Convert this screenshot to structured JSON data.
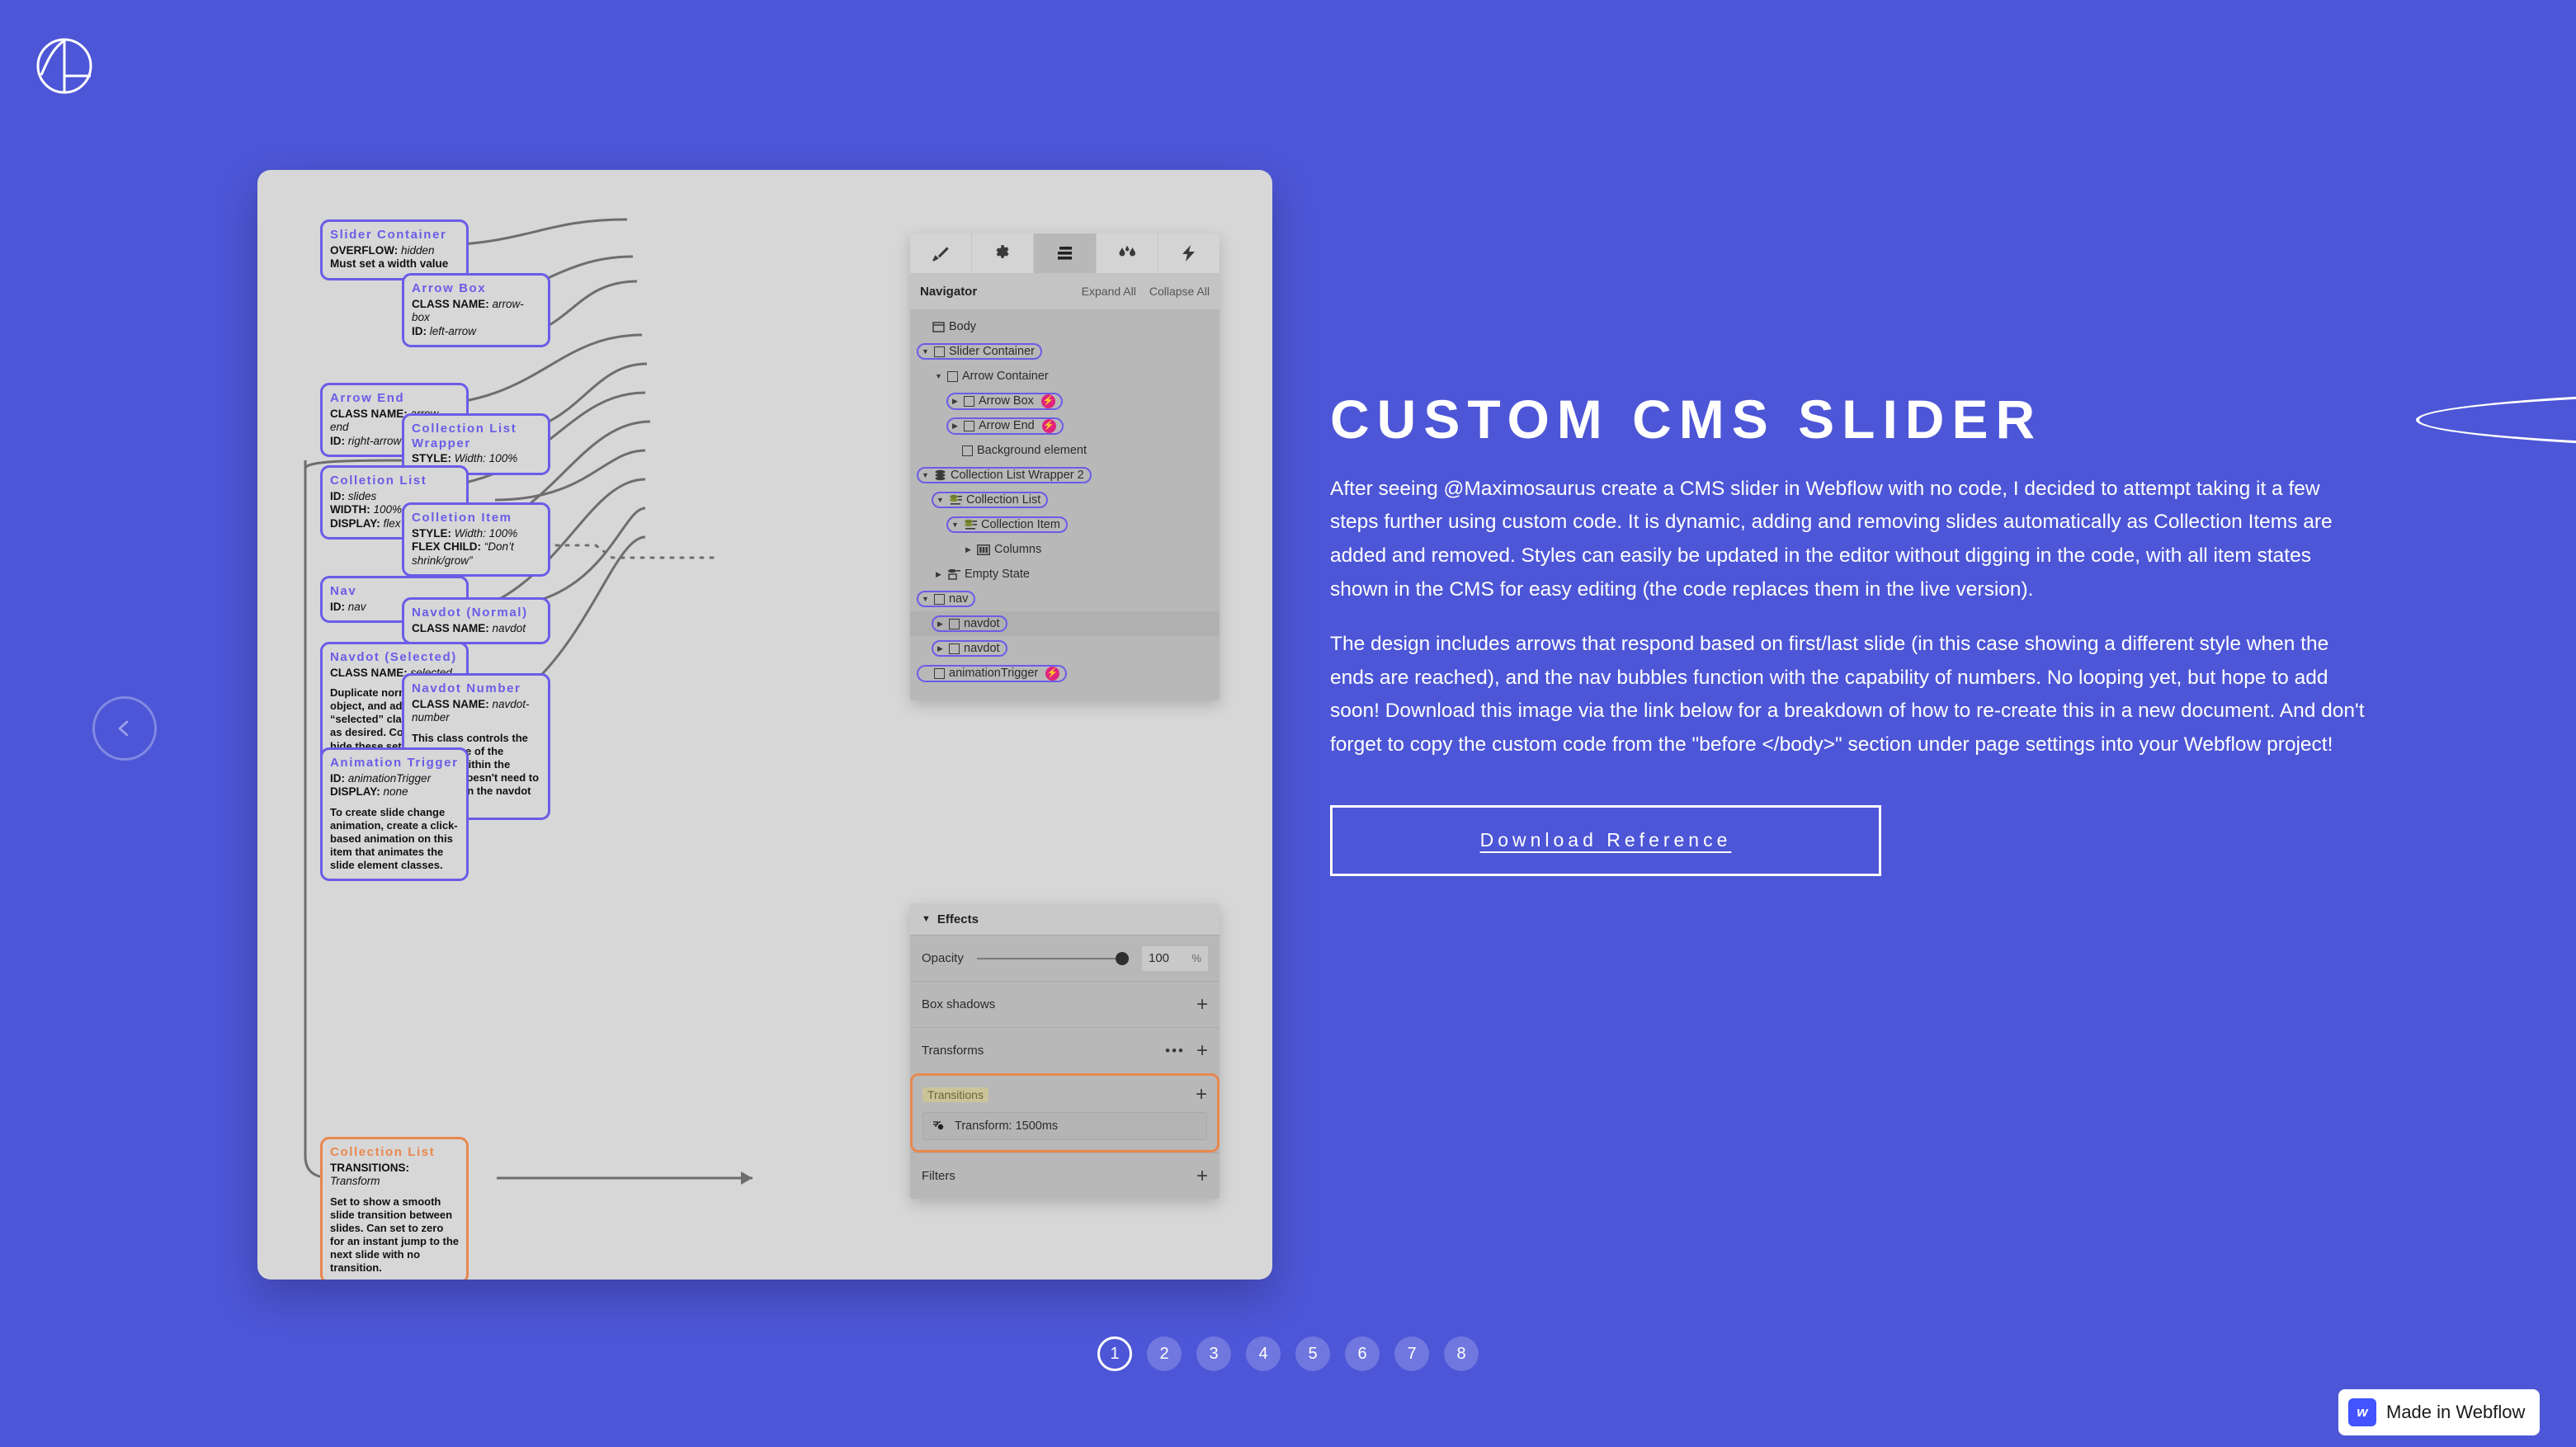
{
  "brand": {
    "logo_icon": "circle-split-logo",
    "webflow_badge": "Made in Webflow",
    "webflow_mark": "w"
  },
  "nav": {
    "prev_icon": "chevron-left-icon",
    "next_icon": "chevron-right-icon",
    "pages": [
      "1",
      "2",
      "3",
      "4",
      "5",
      "6",
      "7",
      "8"
    ],
    "active_page": "1"
  },
  "right": {
    "headline": "Custom CMS Slider",
    "paragraph1": "After seeing @Maximosaurus create a CMS slider in Webflow with no code, I decided to attempt taking it a few steps further using custom code. It is dynamic, adding and removing slides automatically as Collection Items are added and removed. Styles can easily be updated in the editor without digging in the code, with all item states shown in the CMS for easy editing (the code replaces them in the live version).",
    "paragraph2": "The design includes arrows that respond based on first/last slide (in this case showing a different style when the ends are reached), and the nav bubbles function with the capability of numbers. No looping yet, but hope to add soon! Download this image via the link below for a breakdown of how to re-create this in a new document. And don't forget to copy the custom code from the \"before </body>\" section under page settings into your Webflow project!",
    "download_button": "Download Reference"
  },
  "notes": [
    {
      "id": "slider-container",
      "title": "Slider Container",
      "rows": [
        {
          "key": "OVERFLOW:",
          "val": "hidden"
        }
      ],
      "plain": "Must set a width value"
    },
    {
      "id": "arrow-box",
      "title": "Arrow Box",
      "rows": [
        {
          "key": "CLASS NAME:",
          "val": "arrow-box"
        },
        {
          "key": "ID:",
          "val": "left-arrow"
        }
      ]
    },
    {
      "id": "arrow-end",
      "title": "Arrow End",
      "rows": [
        {
          "key": "CLASS NAME:",
          "val": "arrow-end"
        },
        {
          "key": "ID:",
          "val": "right-arrow"
        }
      ]
    },
    {
      "id": "collection-list-wrapper",
      "title": "Collection List Wrapper",
      "rows": [
        {
          "key": "STYLE:",
          "val": "Width: 100%"
        }
      ]
    },
    {
      "id": "collection-list",
      "title": "Colletion List",
      "rows": [
        {
          "key": "ID:",
          "val": "slides"
        },
        {
          "key": "WIDTH:",
          "val": "100%"
        },
        {
          "key": "DISPLAY:",
          "val": "flex"
        }
      ]
    },
    {
      "id": "collection-item",
      "title": "Colletion Item",
      "rows": [
        {
          "key": "STYLE:",
          "val": "Width: 100%"
        },
        {
          "key": "FLEX CHILD:",
          "val": "“Don’t shrink/grow”"
        }
      ]
    },
    {
      "id": "nav",
      "title": "Nav",
      "rows": [
        {
          "key": "ID:",
          "val": "nav"
        }
      ]
    },
    {
      "id": "navdot-normal",
      "title": "Navdot (Normal)",
      "rows": [
        {
          "key": "CLASS NAME:",
          "val": "navdot"
        }
      ]
    },
    {
      "id": "navdot-selected",
      "title": "Navdot (Selected)",
      "rows": [
        {
          "key": "CLASS NAME:",
          "val": "selected"
        }
      ],
      "body": "Duplicate normal navdot object, and add “selected” class. Style as desired. Code will hide these setup dots when the page loads."
    },
    {
      "id": "navdot-number",
      "title": "Navdot Number",
      "rows": [
        {
          "key": "CLASS NAME:",
          "val": "navdot-number"
        }
      ],
      "body": "This class controls the appearance of the numbers within the navdots. Doesn't need to be placed in the navdot containers."
    },
    {
      "id": "animation-trigger",
      "title": "Animation Trigger",
      "rows": [
        {
          "key": "ID:",
          "val": "animationTrigger"
        },
        {
          "key": "DISPLAY:",
          "val": "none"
        }
      ],
      "body": "To create slide change animation, create a click-based animation on this item that animates the slide element classes."
    },
    {
      "id": "collection-list-transitions",
      "title": "Collection List",
      "rows": [
        {
          "key": "TRANSITIONS:",
          "val": "Transform"
        }
      ],
      "body": "Set  to  show a smooth slide transition between slides. Can set to zero for an instant jump to the next slide with no transition."
    }
  ],
  "panel": {
    "tabs": [
      {
        "icon": "paintbrush-icon",
        "active": false
      },
      {
        "icon": "gear-icon",
        "active": false
      },
      {
        "icon": "navigator-icon",
        "active": true
      },
      {
        "icon": "droplets-icon",
        "active": false
      },
      {
        "icon": "lightning-icon",
        "active": false
      }
    ],
    "title": "Navigator",
    "expand_all": "Expand All",
    "collapse_all": "Collapse All",
    "tree": [
      {
        "label": "Body",
        "indent": 0,
        "caret": "none",
        "icon": "page-icon",
        "selected": false,
        "bolt": false
      },
      {
        "label": "Slider Container",
        "indent": 0,
        "caret": "down",
        "icon": "square-icon",
        "selected": true,
        "bolt": false
      },
      {
        "label": "Arrow Container",
        "indent": 1,
        "caret": "down",
        "icon": "square-icon",
        "selected": false,
        "bolt": false
      },
      {
        "label": "Arrow Box",
        "indent": 2,
        "caret": "right",
        "icon": "square-icon",
        "selected": true,
        "bolt": true
      },
      {
        "label": "Arrow End",
        "indent": 2,
        "caret": "right",
        "icon": "square-icon",
        "selected": true,
        "bolt": true
      },
      {
        "label": "Background element",
        "indent": 2,
        "caret": "none",
        "icon": "square-icon",
        "selected": false,
        "bolt": false
      },
      {
        "label": "Collection List Wrapper 2",
        "indent": 0,
        "caret": "down",
        "icon": "stack-icon",
        "selected": true,
        "bolt": false
      },
      {
        "label": "Collection List",
        "indent": 1,
        "caret": "down",
        "icon": "collection-icon",
        "selected": true,
        "bolt": false
      },
      {
        "label": "Collection Item",
        "indent": 2,
        "caret": "down",
        "icon": "collection-icon",
        "selected": true,
        "bolt": false
      },
      {
        "label": "Columns",
        "indent": 3,
        "caret": "right",
        "icon": "columns-icon",
        "selected": false,
        "bolt": false
      },
      {
        "label": "Empty State",
        "indent": 1,
        "caret": "right",
        "icon": "empty-icon",
        "selected": false,
        "bolt": false
      },
      {
        "label": "nav",
        "indent": 0,
        "caret": "down",
        "icon": "square-icon",
        "selected": true,
        "bolt": false
      },
      {
        "label": "navdot",
        "indent": 1,
        "caret": "right",
        "icon": "square-icon",
        "selected": true,
        "bolt": false,
        "hl": true
      },
      {
        "label": "navdot",
        "indent": 1,
        "caret": "right",
        "icon": "square-icon",
        "selected": true,
        "bolt": false
      },
      {
        "label": "animationTrigger",
        "indent": 0,
        "caret": "none",
        "icon": "square-icon",
        "selected": true,
        "bolt": true
      }
    ]
  },
  "effects": {
    "title": "Effects",
    "opacity_label": "Opacity",
    "opacity_value": "100",
    "opacity_unit": "%",
    "box_shadows_label": "Box shadows",
    "transforms_label": "Transforms",
    "transitions_label": "Transitions",
    "transition_item": "Transform: 1500ms",
    "filters_label": "Filters",
    "add_icon": "plus-icon",
    "more_icon": "ellipsis-icon"
  },
  "colors": {
    "background": "#4d56d6",
    "card": "#d7d7d7",
    "note_purple": "#6b5ce7",
    "note_orange": "#e8884e",
    "badge_pink": "#e0247f",
    "panel_gray": "#b8b8b8"
  }
}
